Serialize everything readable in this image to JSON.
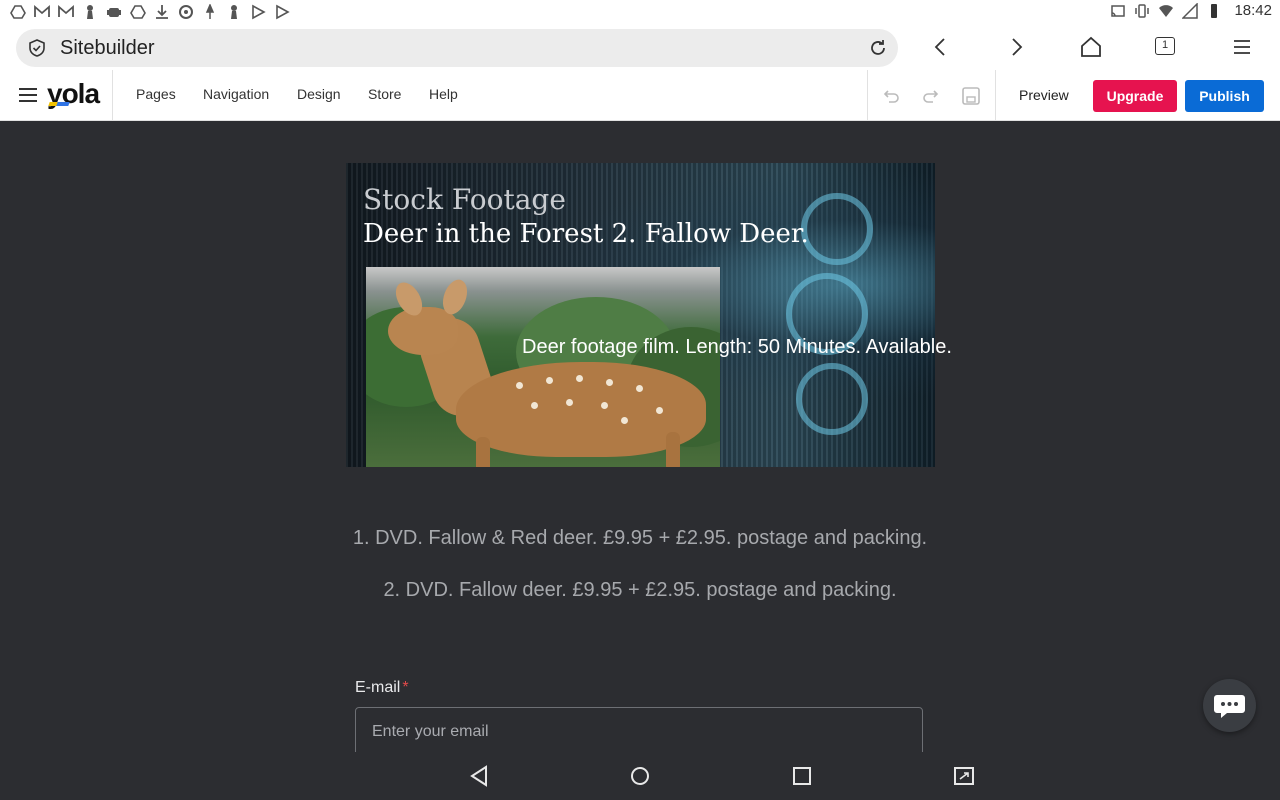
{
  "status_bar": {
    "time": "18:42",
    "left_icons": [
      "drive-icon",
      "gmail-icon",
      "gmail-icon",
      "chess-pawn-icon",
      "android-icon",
      "drive-icon",
      "download-icon",
      "aperture-icon",
      "pin-icon",
      "chess-pawn-icon",
      "play-store-icon",
      "play-store-icon"
    ],
    "right_icons": [
      "cast-icon",
      "vibrate-icon",
      "wifi-icon",
      "signal-icon",
      "battery-icon"
    ]
  },
  "browser": {
    "url_title": "Sitebuilder",
    "tab_count": "1"
  },
  "editor": {
    "logo": "yola",
    "menu": [
      "Pages",
      "Navigation",
      "Design",
      "Store",
      "Help"
    ],
    "preview_label": "Preview",
    "upgrade_label": "Upgrade",
    "publish_label": "Publish"
  },
  "content": {
    "banner_title1": "Stock Footage",
    "banner_title2": "Deer in the Forest 2. Fallow Deer.",
    "banner_caption": "Deer footage film. Length: 50 Minutes. Available.",
    "line1": "1. DVD. Fallow & Red deer. £9.95 + £2.95. postage and packing.",
    "line2": "2. DVD. Fallow deer. £9.95 + £2.95. postage and packing.",
    "email_label": "E-mail",
    "email_required": "*",
    "email_placeholder": "Enter your email"
  },
  "colors": {
    "upgrade": "#e6134f",
    "publish": "#0a6bd6",
    "page_bg": "#2c2d31"
  }
}
